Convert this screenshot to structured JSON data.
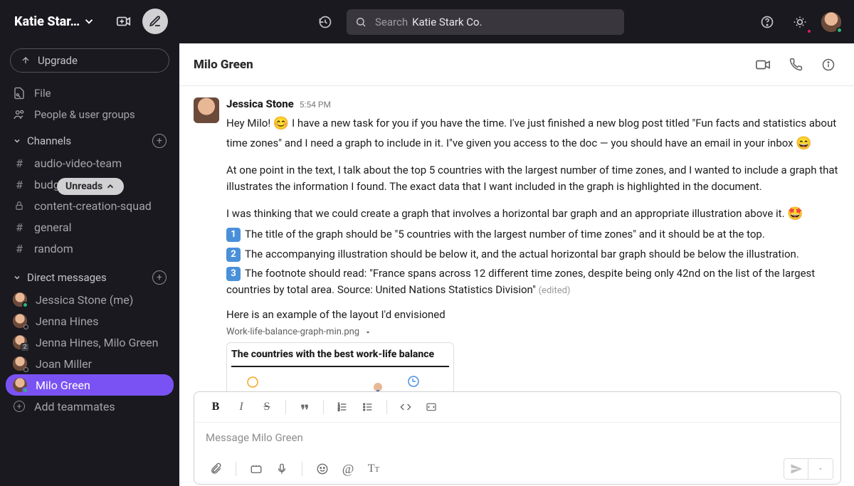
{
  "workspace": {
    "name": "Katie Star…"
  },
  "upgrade_label": "Upgrade",
  "unreads_pill": "Unreads",
  "nav": {
    "file_browser": "File ",
    "people": "People & user groups"
  },
  "channels_heading": "Channels",
  "channels": [
    {
      "prefix": "#",
      "name": "audio-video-team"
    },
    {
      "prefix": "#",
      "name": "budget-proposals"
    },
    {
      "prefix": "lock",
      "name": "content-creation-squad"
    },
    {
      "prefix": "#",
      "name": "general"
    },
    {
      "prefix": "#",
      "name": "random"
    }
  ],
  "dm_heading": "Direct messages",
  "dms": [
    {
      "name": "Jessica Stone (me)",
      "presence": "online",
      "active": false,
      "badge": null
    },
    {
      "name": "Jenna Hines",
      "presence": "away",
      "active": false,
      "badge": null
    },
    {
      "name": "Jenna Hines, Milo Green",
      "presence": "group",
      "active": false,
      "badge": "2"
    },
    {
      "name": "Joan Miller",
      "presence": "away",
      "active": false,
      "badge": null
    },
    {
      "name": "Milo Green",
      "presence": "online",
      "active": true,
      "badge": null
    }
  ],
  "add_teammates": "Add teammates",
  "search": {
    "prefix": "Search",
    "value": "Katie Stark Co."
  },
  "dm_header": {
    "title": "Milo Green"
  },
  "message": {
    "author": "Jessica Stone",
    "time": "5:54 PM",
    "p1a": "Hey Milo! ",
    "p1b": " I have a new task for you if you have the time. I've just finished a new blog post titled \"Fun facts and statistics about time zones\" and I need a graph to include in it. I\"ve given you access to the doc — you should have an email in your inbox ",
    "p2": "At one point in the text, I talk about the top 5 countries with the largest number of time zones, and I wanted to include a graph that illustrates the information I found. The exact data that I want included in the graph is highlighted in the document.",
    "p3": "I was thinking that we could create a graph that involves a horizontal bar graph and an appropriate illustration above it. ",
    "li1": "The title of the graph should be \"5 countries with the largest number of time zones\" and it should be at the top.",
    "li2": "The accompanying illustration should be below it, and the actual horizontal bar graph should be below the illustration.",
    "li3": "The footnote should read: \"France spans across 12 different time zones, despite being only 42nd on the list of the largest countries by total area. Source: United Nations Statistics Division\" ",
    "edited": "(edited)",
    "p4": "Here is an example of the layout I'd envisioned",
    "attachment_name": "Work-life-balance-graph-min.png",
    "attachment_title": "The countries with the best work-life balance"
  },
  "composer": {
    "placeholder": "Message Milo Green"
  }
}
